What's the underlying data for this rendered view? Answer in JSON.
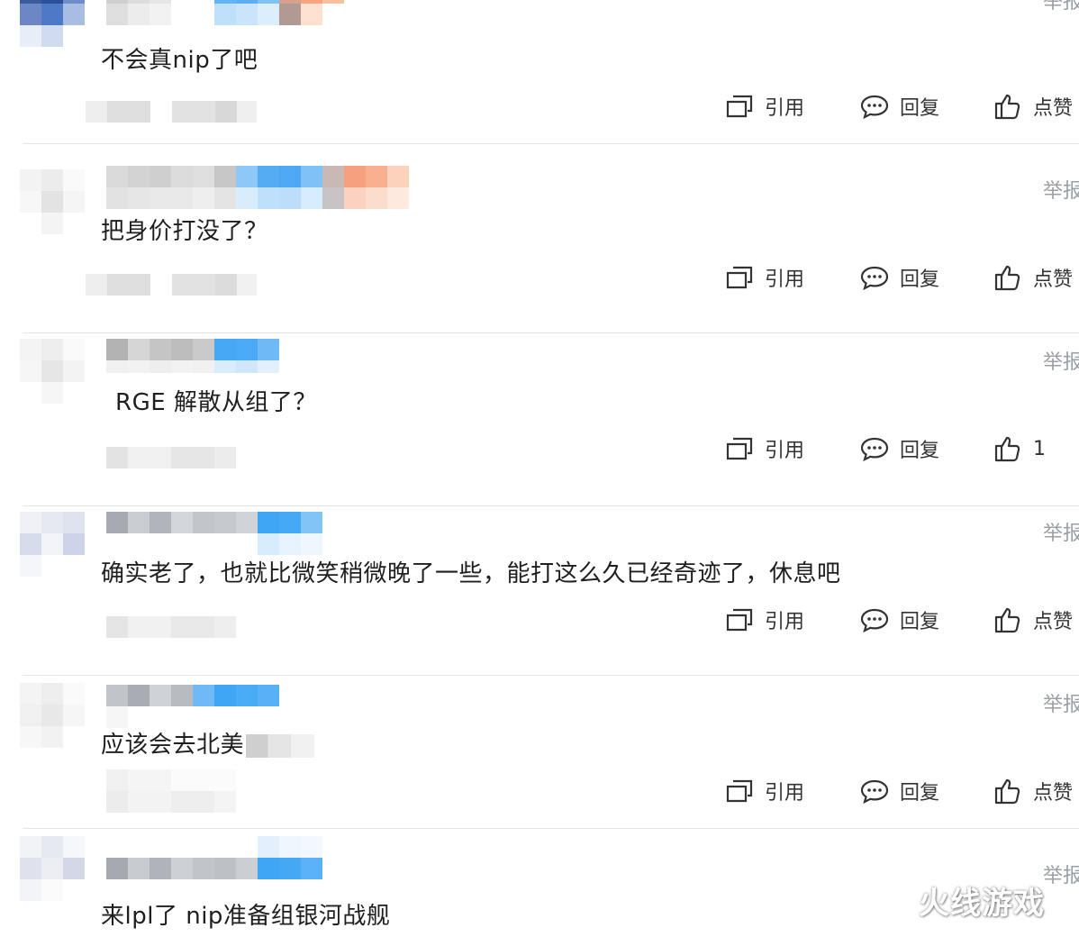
{
  "actions": {
    "quote": "引用",
    "reply": "回复",
    "like": "点赞",
    "report": "举报"
  },
  "comments": [
    {
      "text": "不会真nip了吧",
      "likes": ""
    },
    {
      "text": "把身价打没了？",
      "likes": ""
    },
    {
      "text": "RGE 解散从组了？",
      "likes": "1"
    },
    {
      "text": "确实老了，也就比微笑稍微晚了一些，能打这么久已经奇迹了，休息吧",
      "likes": ""
    },
    {
      "text": "应该会去北美",
      "likes": ""
    },
    {
      "text": "来lpl了 nip准备组银河战舰",
      "likes": ""
    }
  ],
  "watermark": "火线游戏",
  "colors": {
    "pixel_blue": "#3ea6f5",
    "pixel_gray": "#b8bcc2",
    "divider": "#e6e6e6"
  }
}
